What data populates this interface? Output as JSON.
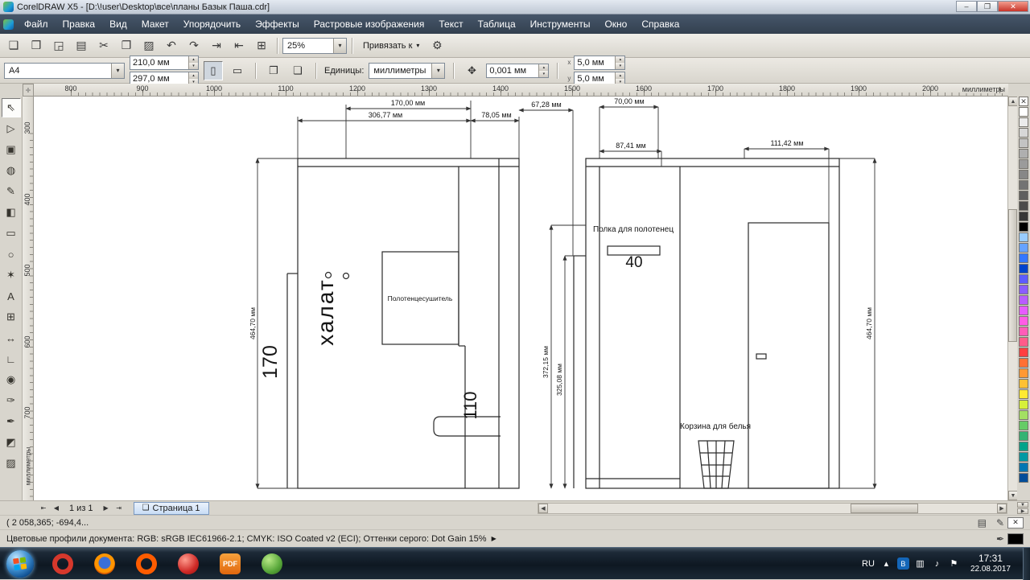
{
  "window": {
    "title": "CorelDRAW X5 - [D:\\!user\\Desktop\\все\\планы Базык Паша.cdr]",
    "controls": {
      "minimize": "–",
      "maximize": "❐",
      "close": "✕"
    }
  },
  "ui": {
    "dropdown_arrow": "▾",
    "spin_up": "▴",
    "spin_down": "▾",
    "scroll_up": "▲",
    "scroll_down": "▼",
    "scroll_left": "◀",
    "scroll_right": "▶",
    "origin_glyph": "✛"
  },
  "menu": {
    "items": [
      "Файл",
      "Правка",
      "Вид",
      "Макет",
      "Упорядочить",
      "Эффекты",
      "Растровые изображения",
      "Текст",
      "Таблица",
      "Инструменты",
      "Окно",
      "Справка"
    ]
  },
  "standard_toolbar": {
    "icons": [
      {
        "name": "new-document-icon",
        "glyph": "❑"
      },
      {
        "name": "open-icon",
        "glyph": "❒"
      },
      {
        "name": "save-icon",
        "glyph": "◲"
      },
      {
        "name": "print-icon",
        "glyph": "▤"
      },
      {
        "name": "cut-icon",
        "glyph": "✂"
      },
      {
        "name": "copy-icon",
        "glyph": "❐"
      },
      {
        "name": "paste-icon",
        "glyph": "▨"
      },
      {
        "name": "undo-icon",
        "glyph": "↶"
      },
      {
        "name": "redo-icon",
        "glyph": "↷"
      },
      {
        "name": "import-icon",
        "glyph": "⇥"
      },
      {
        "name": "export-icon",
        "glyph": "⇤"
      },
      {
        "name": "application-launcher-icon",
        "glyph": "⊞"
      }
    ],
    "zoom_value": "25%",
    "snap_label": "Привязать к",
    "options_glyph": "⚙"
  },
  "property_bar": {
    "paper_size": "A4",
    "paper_width": "210,0 мм",
    "paper_height": "297,0 мм",
    "portrait_glyph": "▯",
    "landscape_glyph": "▭",
    "all_pages_glyph": "❐",
    "current_page_glyph": "❏",
    "units_label": "Единицы:",
    "units_value": "миллиметры",
    "nudge_icon": "✥",
    "nudge_value": "0,001 мм",
    "dup_x_label": "x",
    "dup_y_label": "y",
    "dup_x": "5,0 мм",
    "dup_y": "5,0 мм"
  },
  "rulers": {
    "h_ticks": [
      "800",
      "900",
      "1000",
      "1100",
      "1200",
      "1300",
      "1400",
      "1500",
      "1600",
      "1700",
      "1800",
      "1900",
      "2000"
    ],
    "v_ticks": [
      "300",
      "400",
      "500",
      "600",
      "700"
    ],
    "unit_label": "миллиметры",
    "v_unit_label": "миллиметры"
  },
  "toolbox": {
    "tools": [
      {
        "name": "pick-tool",
        "glyph": "⇖"
      },
      {
        "name": "shape-tool",
        "glyph": "▷"
      },
      {
        "name": "crop-tool",
        "glyph": "▣"
      },
      {
        "name": "zoom-tool",
        "glyph": "◍"
      },
      {
        "name": "freehand-tool",
        "glyph": "✎"
      },
      {
        "name": "smart-fill-tool",
        "glyph": "◧"
      },
      {
        "name": "rectangle-tool",
        "glyph": "▭"
      },
      {
        "name": "ellipse-tool",
        "glyph": "○"
      },
      {
        "name": "polygon-tool",
        "glyph": "✶"
      },
      {
        "name": "text-tool",
        "glyph": "А"
      },
      {
        "name": "table-tool",
        "glyph": "⊞"
      },
      {
        "name": "dimension-tool",
        "glyph": "↔"
      },
      {
        "name": "connector-tool",
        "glyph": "∟"
      },
      {
        "name": "blend-tool",
        "glyph": "◉"
      },
      {
        "name": "eyedropper-tool",
        "glyph": "✑"
      },
      {
        "name": "outline-pen-tool",
        "glyph": "✒"
      },
      {
        "name": "fill-tool",
        "glyph": "◩"
      },
      {
        "name": "interactive-fill-tool",
        "glyph": "▨"
      }
    ]
  },
  "drawing": {
    "dim_170": "170,00 мм",
    "dim_306": "306,77 мм",
    "dim_78": "78,05 мм",
    "dim_464_left": "464,70 мм",
    "robe": "халат",
    "num_170": "170",
    "num_110": "110",
    "towel_rail": "Полотенцесушитель",
    "dim_67": "67,28 мм",
    "dim_70": "70,00 мм",
    "dim_87": "87,41 мм",
    "dim_111": "111,42 мм",
    "shelf_label": "Полка для полотенец",
    "num_40": "40",
    "dim_372": "372,15 мм",
    "dim_325": "325,08 мм",
    "dim_464_right": "464,70 мм",
    "basket_label": "Корзина для белья"
  },
  "navigator": {
    "first_glyph": "⇤",
    "prev_glyph": "◀",
    "page_info": "1 из 1",
    "next_glyph": "▶",
    "last_glyph": "⇥",
    "tab_icon": "❏",
    "tab_label": "Страница 1"
  },
  "status": {
    "coords": "( 2 058,365; -694,4...",
    "profiles": "Цветовые профили документа: RGB: sRGB IEC61966-2.1; CMYK: ISO Coated v2 (ECI); Оттенки серого: Dot Gain 15%",
    "profiles_arrow": "▶",
    "page_icon_glyph": "▤",
    "outline_pen_glyph": "✎",
    "no_fill_glyph": "✕",
    "fill_pen_glyph": "✒"
  },
  "palette": {
    "no_color_glyph": "✕",
    "colors": [
      "#ffffff",
      "#ebebeb",
      "#d7d7d7",
      "#c3c3c3",
      "#afafaf",
      "#9b9b9b",
      "#878787",
      "#737373",
      "#5f5f5f",
      "#4b4b4b",
      "#373737",
      "#000000",
      "#99ccff",
      "#66a3ff",
      "#3377ff",
      "#0044cc",
      "#5c5cff",
      "#8a5cff",
      "#b85cff",
      "#e65cff",
      "#ff5ce6",
      "#ff5cb8",
      "#ff5c8a",
      "#ff4040",
      "#ff7033",
      "#ff9933",
      "#ffc133",
      "#ffea33",
      "#d6f03a",
      "#a3e063",
      "#66cc66",
      "#33b373",
      "#00a38a",
      "#0099a3",
      "#0077b3",
      "#004d99"
    ]
  },
  "taskbar": {
    "apps": [
      {
        "name": "taskbar-app-opera",
        "style": "ring-red",
        "label": "O"
      },
      {
        "name": "taskbar-app-firefox",
        "style": "firefox",
        "label": ""
      },
      {
        "name": "taskbar-app-opera-classic",
        "style": "ring-orange",
        "label": "O"
      },
      {
        "name": "taskbar-app-red",
        "style": "disc-red",
        "label": ""
      },
      {
        "name": "taskbar-app-pdf",
        "style": "tile-orange",
        "label": "PDF"
      },
      {
        "name": "taskbar-app-green",
        "style": "disc-green",
        "label": ""
      }
    ],
    "tray": {
      "lang": "RU",
      "icons": [
        {
          "name": "hidden-icons-chevron",
          "glyph": "▴",
          "cls": ""
        },
        {
          "name": "bluetooth-icon",
          "glyph": "B",
          "cls": "bt"
        },
        {
          "name": "network-icon",
          "glyph": "▥",
          "cls": ""
        },
        {
          "name": "volume-icon",
          "glyph": "♪",
          "cls": ""
        },
        {
          "name": "action-center-flag-icon",
          "glyph": "⚑",
          "cls": ""
        }
      ],
      "time": "17:31",
      "date": "22.08.2017"
    }
  }
}
